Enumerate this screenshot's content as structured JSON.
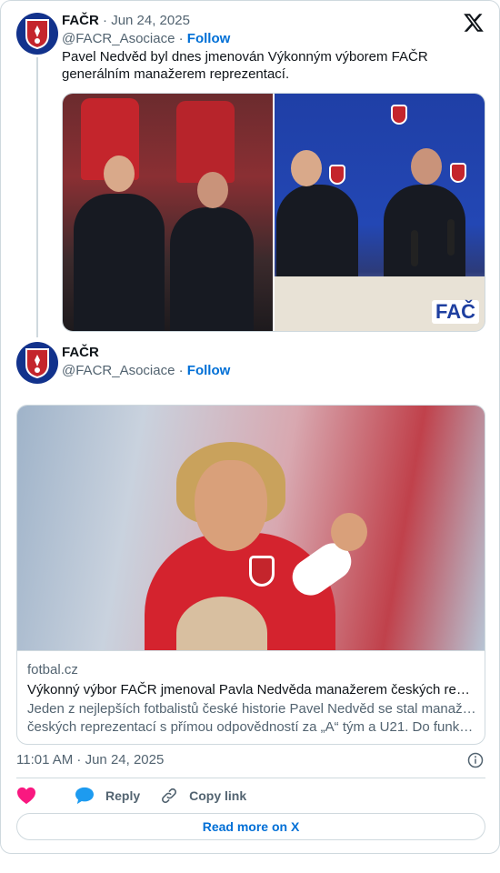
{
  "tweet": {
    "author_name": "FAČR",
    "handle": "@FACR_Asociace",
    "date": "Jun 24, 2025",
    "follow_label": "Follow",
    "separator": "·",
    "text": "Pavel Nedvěd byl dnes jmenován Výkonným výborem FAČR generálním manažerem reprezentací.",
    "media_badge_text": "FAČ"
  },
  "quoted": {
    "author_name": "FAČR",
    "handle": "@FACR_Asociace",
    "follow_label": "Follow",
    "separator": "·"
  },
  "link_card": {
    "domain": "fotbal.cz",
    "title": "Výkonný výbor FAČR jmenoval Pavla Nedvěda manažerem českých reprezentací",
    "description_line1": "Jeden z nejlepších fotbalistů české historie Pavel Nedvěd se stal manažerem",
    "description_line2": "českých reprezentací s přímou odpovědností za „A“ tým a U21. Do funkce ho jmenoval"
  },
  "footer": {
    "timestamp": "11:01 AM · Jun 24, 2025",
    "reply_label": "Reply",
    "copy_link_label": "Copy link",
    "read_more_label": "Read more on X"
  },
  "colors": {
    "follow_blue": "#006fd6",
    "heart_pink": "#f91880",
    "reply_blue": "#1d9bf0",
    "avatar_navy": "#12328c",
    "crest_red": "#c4252c"
  },
  "icons": [
    "x-logo-icon",
    "heart-icon",
    "reply-bubble-icon",
    "link-icon",
    "info-icon",
    "facr-crest-icon"
  ]
}
